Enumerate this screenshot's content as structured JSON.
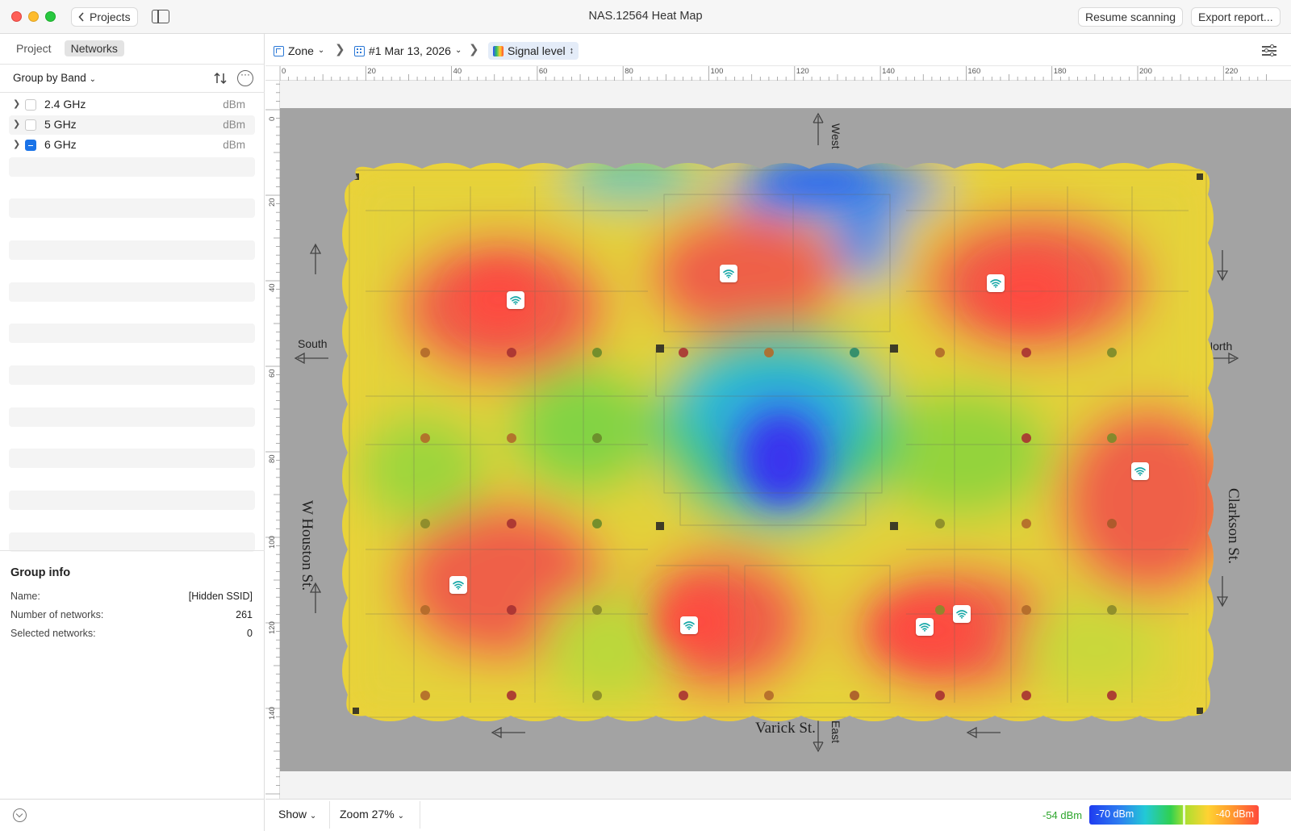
{
  "window": {
    "title": "NAS.12564 Heat Map",
    "back_label": "Projects",
    "resume_label": "Resume scanning",
    "export_label": "Export report..."
  },
  "sidebar": {
    "tabs": [
      {
        "label": "Project",
        "active": false
      },
      {
        "label": "Networks",
        "active": true
      }
    ],
    "group_by_label": "Group by Band",
    "bands": [
      {
        "name": "2.4 GHz",
        "unit": "dBm",
        "checked": "unchecked"
      },
      {
        "name": "5 GHz",
        "unit": "dBm",
        "checked": "unchecked"
      },
      {
        "name": "6 GHz",
        "unit": "dBm",
        "checked": "mixed"
      }
    ],
    "group_info": {
      "title": "Group info",
      "rows": [
        {
          "label": "Name:",
          "value": "[Hidden SSID]"
        },
        {
          "label": "Number of networks:",
          "value": "261"
        },
        {
          "label": "Selected networks:",
          "value": "0"
        }
      ]
    }
  },
  "toolbar": {
    "zone_label": "Zone",
    "scan_label": "#1 Mar 13, 2026",
    "visualization_label": "Signal level"
  },
  "rulers": {
    "horizontal": [
      "0",
      "20",
      "40",
      "60",
      "80",
      "100",
      "120",
      "140",
      "160",
      "180",
      "200",
      "220"
    ],
    "vertical": [
      "0",
      "20",
      "40",
      "60",
      "80",
      "100",
      "120",
      "140"
    ]
  },
  "map": {
    "streets": {
      "west": "W Houston St.",
      "east": "Clarkson St.",
      "south": "Varick St."
    },
    "directions": {
      "west": "West",
      "south": "South",
      "north": "North",
      "east": "East"
    },
    "access_point_icon": "wifi-icon",
    "access_points_count": 9
  },
  "bottom": {
    "show_label": "Show",
    "zoom_label": "Zoom 27%",
    "legend_value": "-54 dBm",
    "legend_min": "-70 dBm",
    "legend_max": "-40 dBm",
    "legend_min_color": "#1f3cf0",
    "legend_max_color": "#ff4a3c"
  }
}
